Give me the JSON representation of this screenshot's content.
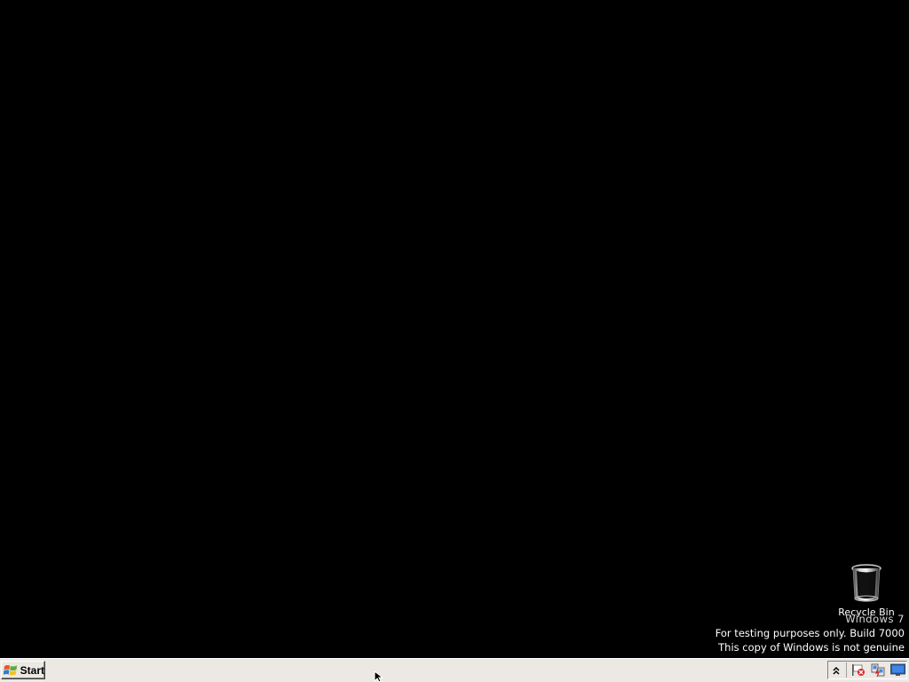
{
  "desktop": {
    "background_color": "#000000",
    "icons": [
      {
        "label": "Recycle Bin",
        "icon": "recycle-bin-icon"
      }
    ]
  },
  "watermark": {
    "title": "Windows 7",
    "line1": "For testing purposes only. Build 7000",
    "line2": "This copy of Windows is not genuine"
  },
  "taskbar": {
    "background_color": "#ece9e4",
    "start_label": "Start",
    "start_icon": "windows-flag-icon",
    "tray_icons": [
      "show-hidden-icons-chevron",
      "action-center-flag-icon",
      "network-icon",
      "show-desktop-icon"
    ]
  }
}
